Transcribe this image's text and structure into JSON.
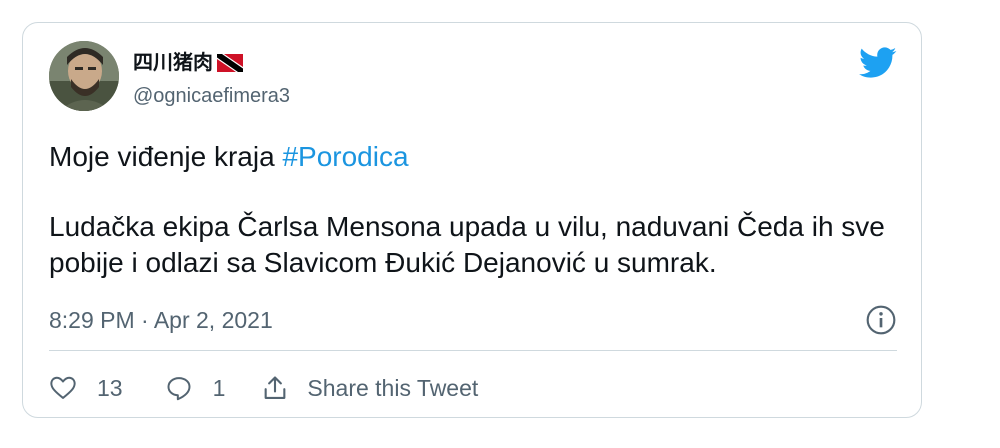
{
  "tweet": {
    "author": {
      "display_name": "四川猪肉",
      "handle": "@ognicaefimera3",
      "avatar_icon": "avatar-photo",
      "flag_icon": "trinidad-and-tobago-flag"
    },
    "platform_icon": "twitter-bird-icon",
    "text": {
      "line1_prefix": "Moje viđenje kraja ",
      "hashtag": "#Porodica",
      "paragraph2": "Ludačka ekipa Čarlsa Mensona upada u vilu, naduvani Čeda ih sve pobije i odlazi sa Slavicom Đukić Dejanović u sumrak."
    },
    "timestamp": "8:29 PM · Apr 2, 2021",
    "actions": {
      "likes_count": "13",
      "replies_count": "1",
      "share_label": "Share this Tweet"
    }
  },
  "colors": {
    "accent": "#1da1f2",
    "hashtag": "#1b95e0",
    "secondary_text": "#536471",
    "border": "#cfd9de",
    "flag_red": "#ce1126"
  }
}
